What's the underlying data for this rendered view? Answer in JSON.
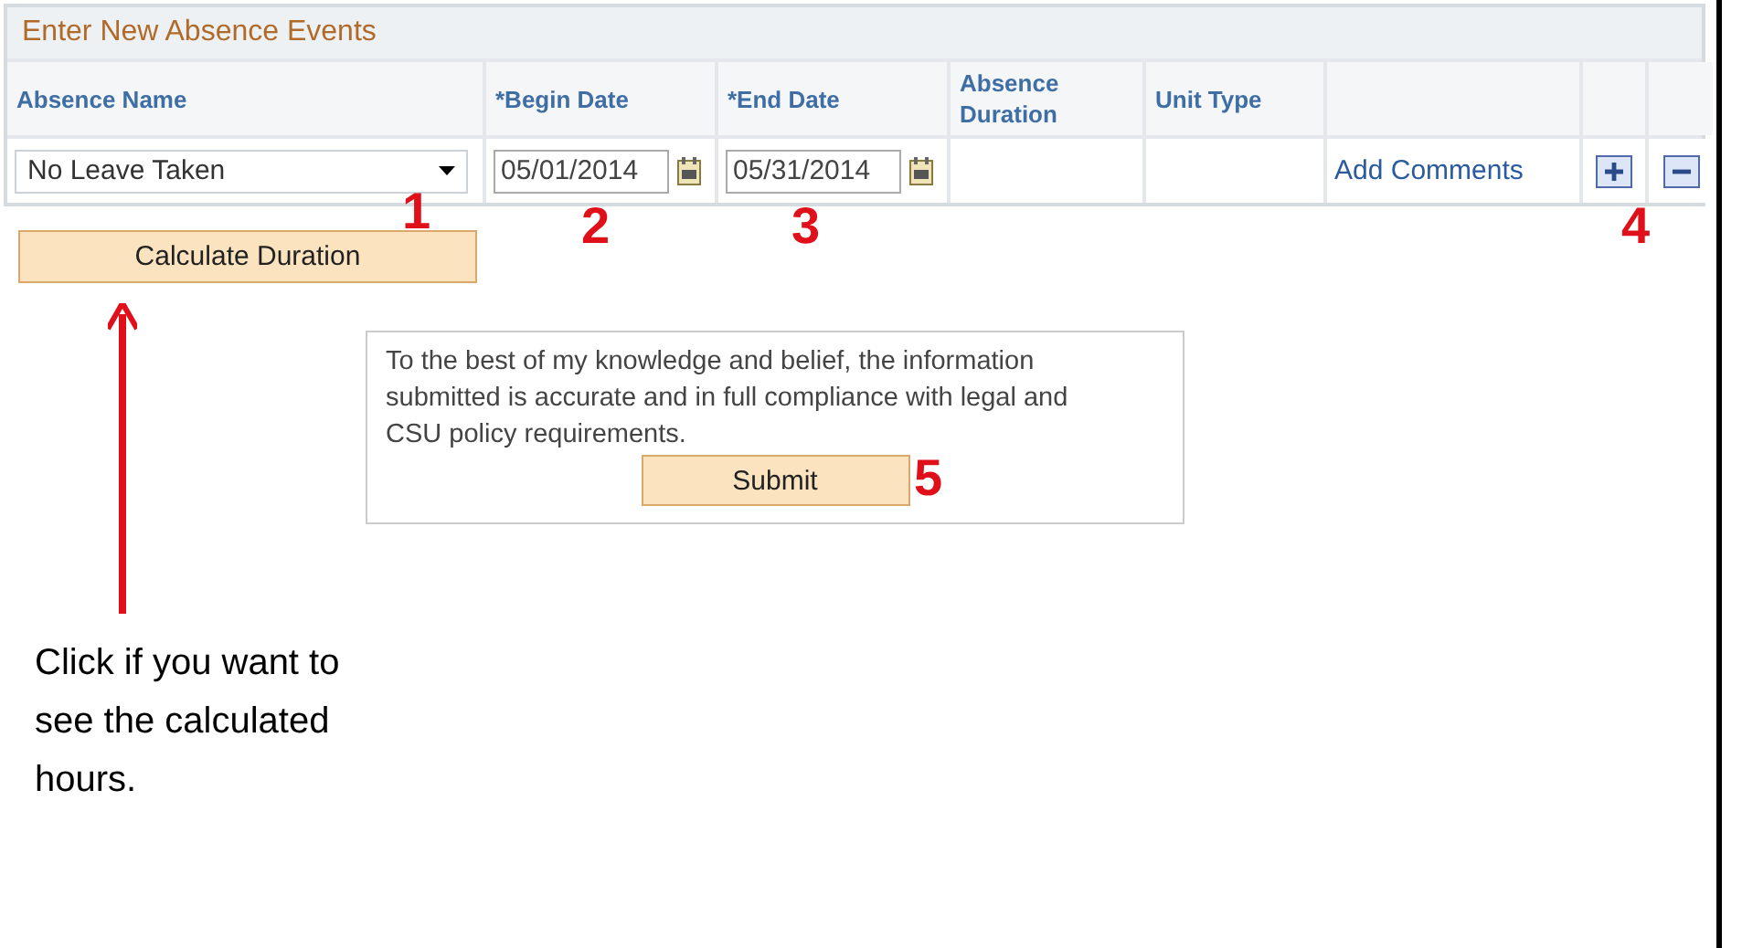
{
  "section": {
    "title": "Enter New Absence Events",
    "columns": [
      "Absence Name",
      "*Begin Date",
      "*End Date",
      "Absence Duration",
      "Unit Type"
    ],
    "row": {
      "absence_name": "No Leave Taken",
      "begin_date": "05/01/2014",
      "end_date": "05/31/2014",
      "comments_link": "Add Comments"
    }
  },
  "calculate_button": "Calculate Duration",
  "attestation": {
    "text": "To the best of my knowledge and belief, the information submitted is accurate and in full compliance with legal and CSU policy requirements.",
    "submit_button": "Submit"
  },
  "callouts": [
    "1",
    "2",
    "3",
    "4",
    "5"
  ],
  "note": "Click if you want to see the calculated hours."
}
